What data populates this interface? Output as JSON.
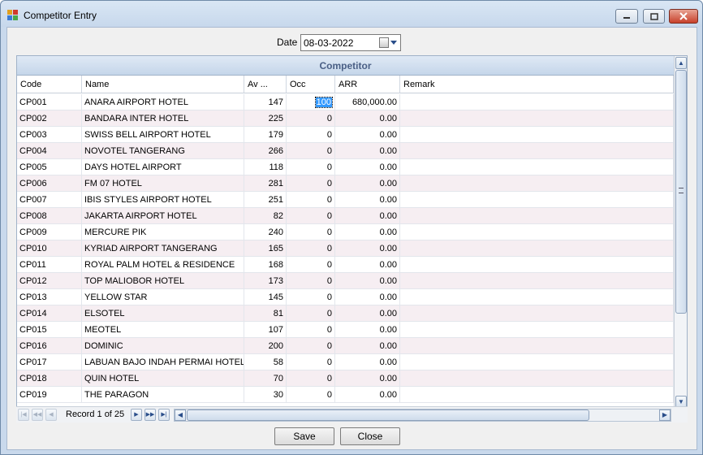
{
  "window": {
    "title": "Competitor Entry"
  },
  "icons": {
    "app": "app-icon",
    "minimize": "minimize-icon",
    "maximize": "maximize-icon",
    "close": "close-icon",
    "calendar": "calendar-icon",
    "dropdown": "chevron-down-icon"
  },
  "date": {
    "label": "Date",
    "value": "08-03-2022"
  },
  "grid": {
    "group_title": "Competitor",
    "columns": [
      "Code",
      "Name",
      "Av ...",
      "Occ",
      "ARR",
      "Remark"
    ],
    "rows": [
      [
        "CP001",
        "ANARA AIRPORT HOTEL",
        "147",
        "100",
        "680,000.00",
        ""
      ],
      [
        "CP002",
        "BANDARA INTER HOTEL",
        "225",
        "0",
        "0.00",
        ""
      ],
      [
        "CP003",
        "SWISS BELL AIRPORT HOTEL",
        "179",
        "0",
        "0.00",
        ""
      ],
      [
        "CP004",
        "NOVOTEL TANGERANG",
        "266",
        "0",
        "0.00",
        ""
      ],
      [
        "CP005",
        "DAYS HOTEL AIRPORT",
        "118",
        "0",
        "0.00",
        ""
      ],
      [
        "CP006",
        "FM 07 HOTEL",
        "281",
        "0",
        "0.00",
        ""
      ],
      [
        "CP007",
        "IBIS STYLES AIRPORT HOTEL",
        "251",
        "0",
        "0.00",
        ""
      ],
      [
        "CP008",
        "JAKARTA AIRPORT HOTEL",
        "82",
        "0",
        "0.00",
        ""
      ],
      [
        "CP009",
        "MERCURE PIK",
        "240",
        "0",
        "0.00",
        ""
      ],
      [
        "CP010",
        "KYRIAD AIRPORT TANGERANG",
        "165",
        "0",
        "0.00",
        ""
      ],
      [
        "CP011",
        "ROYAL PALM HOTEL & RESIDENCE",
        "168",
        "0",
        "0.00",
        ""
      ],
      [
        "CP012",
        "TOP MALIOBOR HOTEL",
        "173",
        "0",
        "0.00",
        ""
      ],
      [
        "CP013",
        "YELLOW STAR",
        "145",
        "0",
        "0.00",
        ""
      ],
      [
        "CP014",
        "ELSOTEL",
        "81",
        "0",
        "0.00",
        ""
      ],
      [
        "CP015",
        "MEOTEL",
        "107",
        "0",
        "0.00",
        ""
      ],
      [
        "CP016",
        "DOMINIC",
        "200",
        "0",
        "0.00",
        ""
      ],
      [
        "CP017",
        "LABUAN BAJO INDAH PERMAI HOTEL",
        "58",
        "0",
        "0.00",
        ""
      ],
      [
        "CP018",
        "QUIN HOTEL",
        "70",
        "0",
        "0.00",
        ""
      ],
      [
        "CP019",
        "THE PARAGON",
        "30",
        "0",
        "0.00",
        ""
      ]
    ],
    "record_text": "Record 1 of 25"
  },
  "buttons": {
    "save": "Save",
    "close": "Close"
  }
}
